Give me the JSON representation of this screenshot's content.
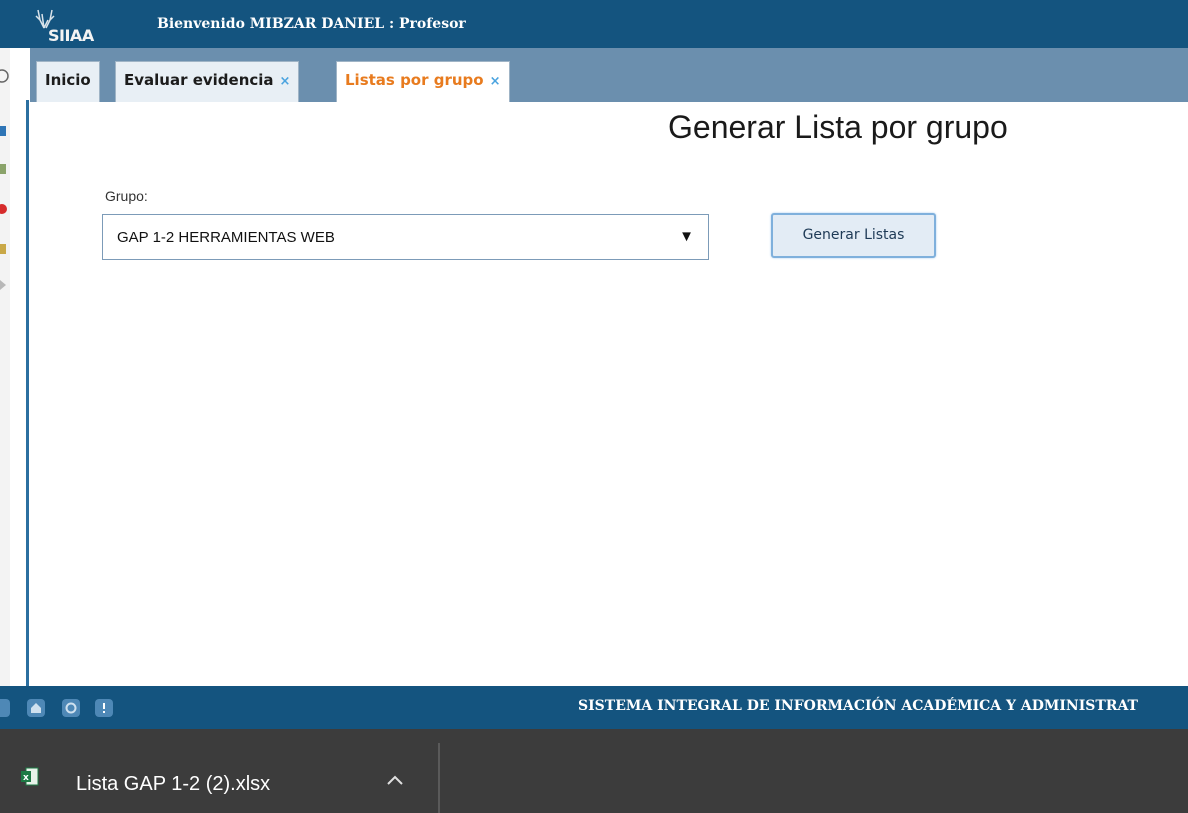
{
  "header": {
    "logo_text": "SIIAA",
    "welcome": "Bienvenido MIBZAR DANIEL : Profesor"
  },
  "tabs": [
    {
      "label": "Inicio",
      "closable": false,
      "active": false
    },
    {
      "label": "Evaluar evidencia",
      "closable": true,
      "active": false
    },
    {
      "label": "Listas por grupo",
      "closable": true,
      "active": true
    }
  ],
  "tab_close_symbol": "×",
  "main": {
    "title": "Generar Lista por grupo",
    "grupo_label": "Grupo:",
    "grupo_selected": "GAP 1-2 HERRAMIENTAS WEB",
    "select_arrow": "▼",
    "generate_button": "Generar Listas"
  },
  "footer": {
    "text": "SISTEMA INTEGRAL DE INFORMACIÓN ACADÉMICA Y ADMINISTRAT",
    "icons": [
      "home-icon",
      "refresh-icon",
      "info-icon"
    ]
  },
  "downloads": {
    "file_name": "Lista GAP 1-2 (2).xlsx",
    "file_icon": "excel-file-icon"
  },
  "colors": {
    "header_bg": "#14547f",
    "tabbar_bg": "#6b8fae",
    "active_tab_text": "#e87b1e",
    "close_icon": "#4aa3df",
    "shelf_bg": "#3c3c3c"
  }
}
